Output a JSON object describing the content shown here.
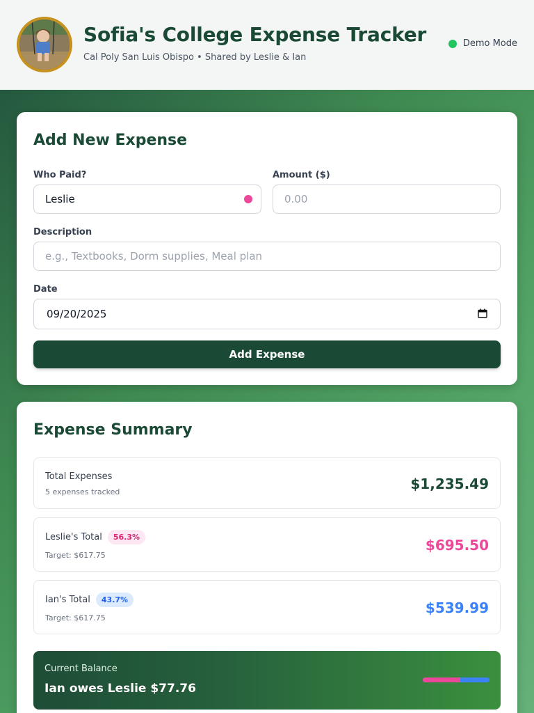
{
  "header": {
    "title": "Sofia's College Expense Tracker",
    "subtitle": "Cal Poly San Luis Obispo • Shared by Leslie & Ian",
    "status": "Demo Mode",
    "status_color": "#22c55e"
  },
  "add_expense": {
    "heading": "Add New Expense",
    "who_paid_label": "Who Paid?",
    "who_paid_value": "Leslie",
    "amount_label": "Amount ($)",
    "amount_placeholder": "0.00",
    "description_label": "Description",
    "description_placeholder": "e.g., Textbooks, Dorm supplies, Meal plan",
    "date_label": "Date",
    "date_value": "09/20/2025",
    "submit_label": "Add Expense"
  },
  "summary": {
    "heading": "Expense Summary",
    "total": {
      "label": "Total Expenses",
      "sub": "5 expenses tracked",
      "amount": "$1,235.49"
    },
    "leslie": {
      "label": "Leslie's Total",
      "percent": "56.3%",
      "target": "Target: $617.75",
      "amount": "$695.50",
      "color": "#ec4899"
    },
    "ian": {
      "label": "Ian's Total",
      "percent": "43.7%",
      "target": "Target: $617.75",
      "amount": "$539.99",
      "color": "#3b82f6"
    },
    "balance": {
      "label": "Current Balance",
      "value": "Ian owes Leslie $77.76",
      "leslie_share": 0.563
    }
  }
}
